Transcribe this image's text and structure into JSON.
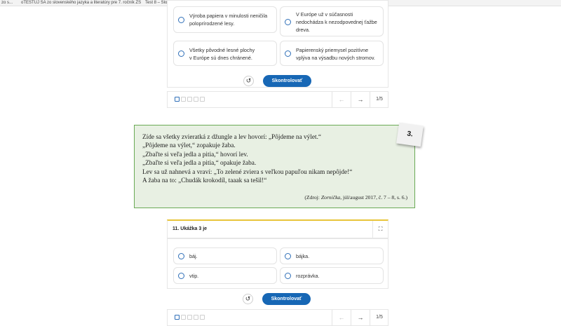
{
  "tabs": [
    {
      "label": "zo s..."
    },
    {
      "label": "oTESTUJ SA zo slovenského jazyka a literatúry pre 7. ročník ZŠ"
    },
    {
      "label": "Test 8 – Slovesá"
    }
  ],
  "top_question": {
    "options": [
      {
        "text_lines": [
          "Výroba papiera v minulosti neničila",
          "poloprírodzené lesy."
        ]
      },
      {
        "text_lines": [
          "V Európe už v súčasnosti",
          "nedochádza k nezodpovednej ťažbe",
          "dreva."
        ]
      },
      {
        "text_lines": [
          "Všetky pôvodné lesné plochy",
          "v Európe sú dnes chránené."
        ]
      },
      {
        "text_lines": [
          "Papierenský priemysel pozitívne",
          "vplýva na výsadbu nových stromov."
        ]
      }
    ],
    "check_label": "Skontrolovať",
    "pager": "1/5"
  },
  "excerpt": {
    "badge": "3.",
    "lines": [
      "Zíde sa všetky zvieratká z džungle a lev hovorí: „Pôjdeme na výlet.“",
      "„Pôjdeme na výlet,“ zopakuje žaba.",
      "„Zbaľte si veľa jedla a pitia,“ hovorí lev.",
      "„Zbaľte si veľa jedla a pitia,“ opakuje žaba.",
      "Lev sa už nahnevá a vraví: „To zelené zviera s veľkou papuľou nikam nepôjde!“",
      "A žaba na to: „Chudák krokodíl, taaak sa tešil!“"
    ],
    "source_prefix": "(Zdroj: ",
    "source_italic": "Zornička",
    "source_suffix": ", júl/august 2017, č. 7 – 8, s. 6.)"
  },
  "question11": {
    "title": "11. Ukážka 3 je",
    "options": [
      {
        "text": "bájka."
      },
      {
        "text": "báj."
      },
      {
        "text": "vtip."
      },
      {
        "text": "rozprávka."
      }
    ],
    "check_label": "Skontrolovať",
    "pager": "1/5"
  },
  "icons": {
    "undo": "↺",
    "prev": "←",
    "next": "→",
    "expand": "⛶"
  },
  "colors": {
    "accent": "#1767b5",
    "excerpt_border": "#6aaa55",
    "excerpt_bg": "#e8f0e3",
    "header_top": "#e8c53a"
  }
}
